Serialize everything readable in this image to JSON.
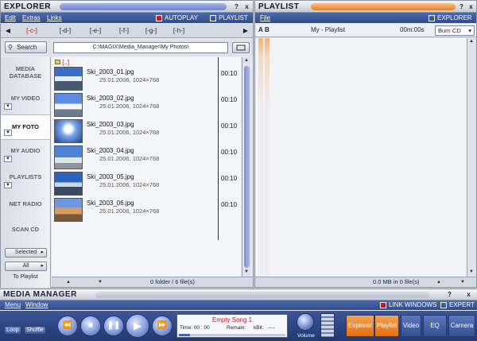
{
  "explorer": {
    "title": "EXPLORER",
    "menu": [
      "Edit",
      "Extras",
      "Links"
    ],
    "autoplay_label": "AUTOPLAY",
    "playlist_label": "PLAYLIST",
    "help": "?",
    "close": "x",
    "drives": [
      "[-c-]",
      "[-d-]",
      "[-e-]",
      "[-f-]",
      "[-g-]",
      "[-h-]"
    ],
    "search_label": "Search",
    "path": "C:\\MAGIX\\Media_Manager\\My Photos\\",
    "parent_dir": "[..]",
    "sidebar": [
      {
        "label": "MEDIA DATABASE"
      },
      {
        "label": "MY VIDEO"
      },
      {
        "label": "MY FOTO"
      },
      {
        "label": "MY AUDIO"
      },
      {
        "label": "PLAYLISTS"
      },
      {
        "label": "NET RADIO"
      },
      {
        "label": "SCAN CD"
      }
    ],
    "selected_label": "Selected",
    "all_label": "All",
    "to_playlist_label": "To Playlist",
    "files": [
      {
        "name": "Ski_2003_01.jpg",
        "date": "25.01.2006,",
        "size": "1024×768",
        "duration": "00:10"
      },
      {
        "name": "Ski_2003_02.jpg",
        "date": "25.01.2006,",
        "size": "1024×768",
        "duration": "00:10"
      },
      {
        "name": "Ski_2003_03.jpg",
        "date": "25.01.2006,",
        "size": "1024×768",
        "duration": "00:10"
      },
      {
        "name": "Ski_2003_04.jpg",
        "date": "25.01.2006,",
        "size": "1024×768",
        "duration": "00:10"
      },
      {
        "name": "Ski_2003_05.jpg",
        "date": "25.01.2006,",
        "size": "1024×768",
        "duration": "00:10"
      },
      {
        "name": "Ski_2003_06.jpg",
        "date": "25.01.2006,",
        "size": "1024×768",
        "duration": "00:10"
      }
    ],
    "status": "0 folder / 6 file(s)"
  },
  "playlist": {
    "title": "PLAYLIST",
    "menu": [
      "File"
    ],
    "explorer_label": "EXPLORER",
    "help": "?",
    "close": "x",
    "col_a": "A",
    "col_b": "B",
    "name": "My - Playlist",
    "duration": "00m:00s",
    "burn_label": "Burn CD",
    "status": "0.0 MB in 0 file(s)"
  },
  "media_manager": {
    "title": "MEDIA MANAGER",
    "menu": [
      "Menu",
      "Window"
    ],
    "link_windows_label": "LINK WINDOWS",
    "expert_label": "EXPERT",
    "help": "?",
    "close": "x",
    "loop_label": "Loop",
    "shuffle_label": "Shuffle",
    "song": "Empty Song 1",
    "time_label": "Time: 00 : 00",
    "remain_label": "Remain:",
    "bitrate_label": "kBit:",
    "bitrate_value": "----",
    "volume_label": "Volume",
    "tabs": [
      "Explorer",
      "Playlist",
      "Video",
      "EQ",
      "Camera"
    ]
  },
  "colors": {
    "accent_red": "#c4161c",
    "accent_orange": "#e8801f",
    "menubar_blue": "#2f4b8c"
  }
}
